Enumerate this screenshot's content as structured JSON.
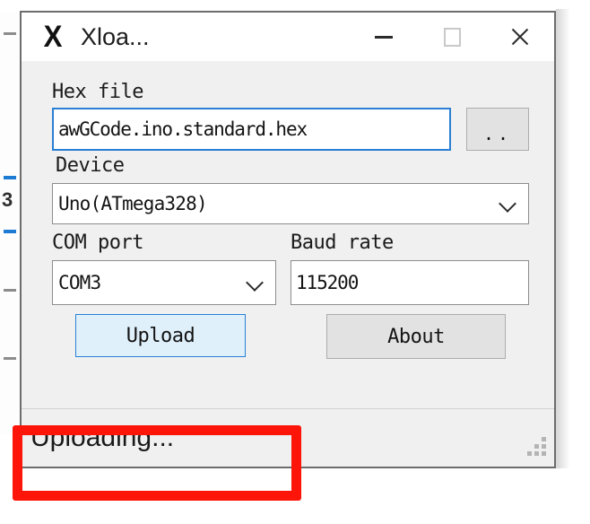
{
  "window": {
    "title": "Xloa...",
    "icon": "X",
    "icon_name": "app-x-icon",
    "caption": {
      "minimize": "—",
      "maximize": "□",
      "close": "✕"
    }
  },
  "form": {
    "hex_file": {
      "label": "Hex file",
      "value": "awGCode.ino.standard.hex",
      "placeholder": "",
      "browse_label": ".."
    },
    "device": {
      "label": "Device",
      "value": "Uno(ATmega328)"
    },
    "com_port": {
      "label": "COM port",
      "value": "COM3"
    },
    "baud_rate": {
      "label": "Baud rate",
      "value": "115200",
      "placeholder": ""
    }
  },
  "buttons": {
    "upload": "Upload",
    "about": "About"
  },
  "status": {
    "text": "Uploading..."
  },
  "colors": {
    "accent_blue": "#2a7fd4",
    "default_button_fill": "#dff0fb",
    "annotation_red": "#fc1508",
    "window_face": "#f0f0f0"
  }
}
